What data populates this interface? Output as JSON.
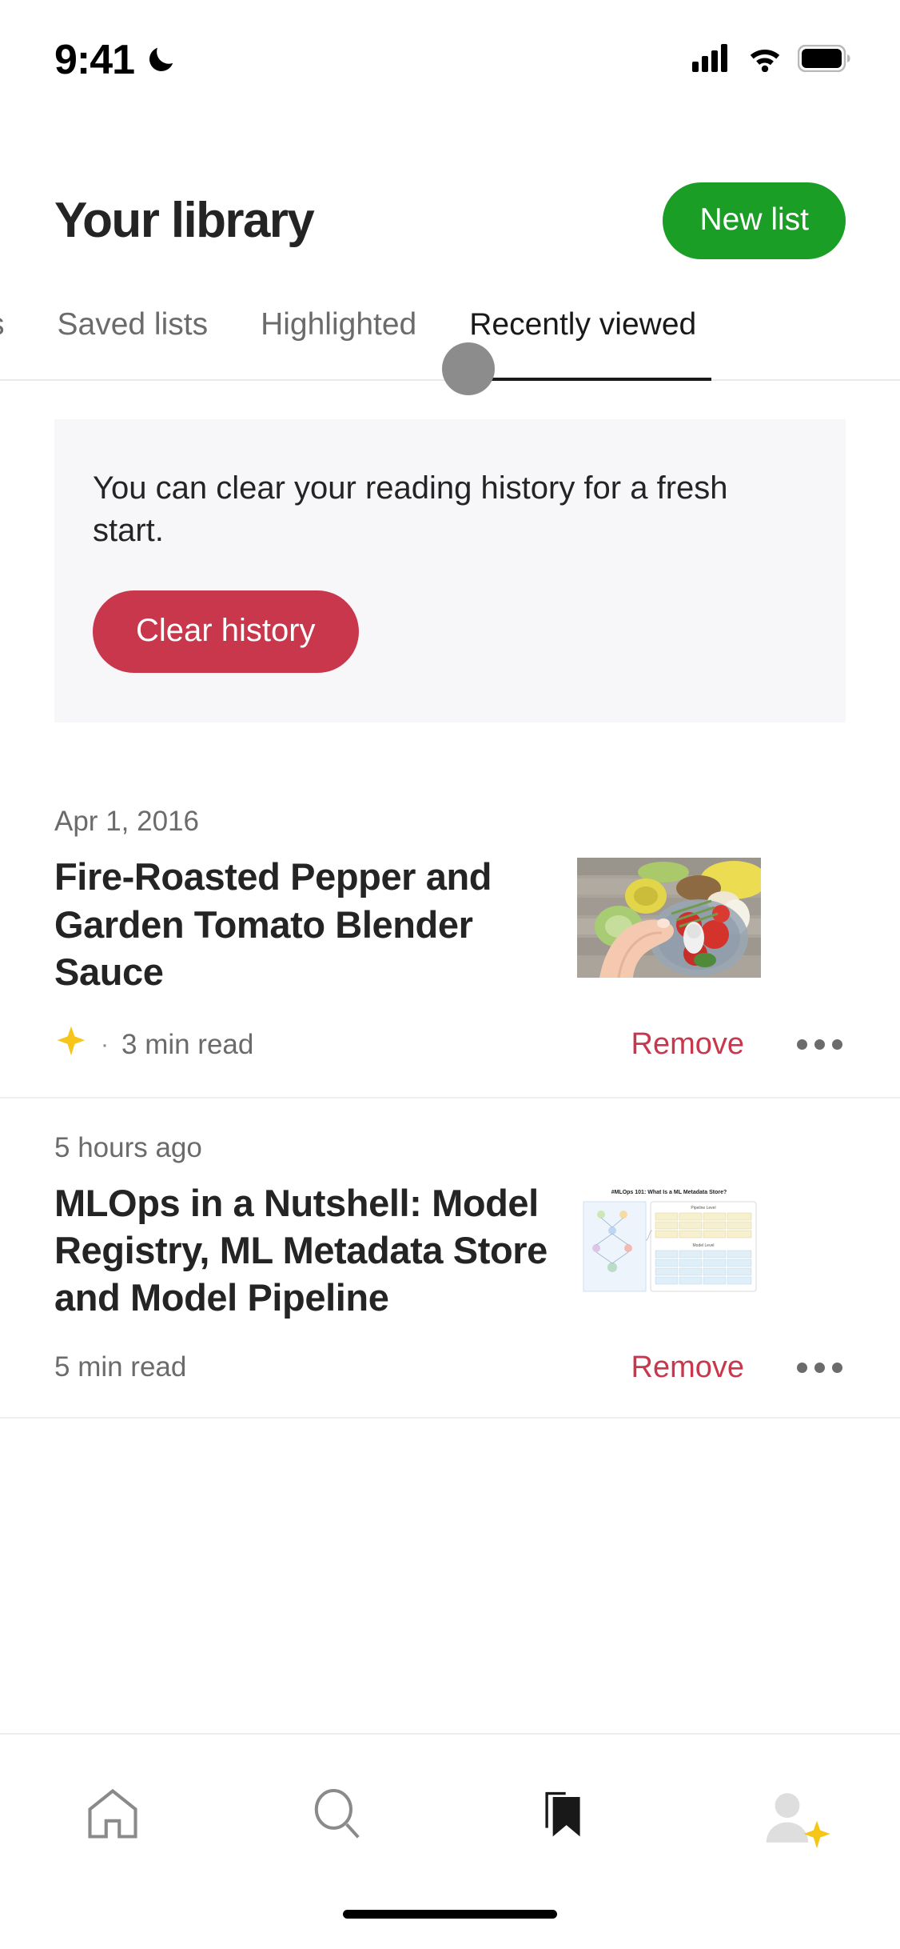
{
  "status_bar": {
    "time": "9:41",
    "dnd_icon": "crescent-moon-icon",
    "cellular_icon": "cellular-signal-icon",
    "wifi_icon": "wifi-icon",
    "battery_icon": "battery-full-icon"
  },
  "header": {
    "title": "Your library",
    "new_list_label": "New list",
    "new_list_color": "#1a9e26"
  },
  "tabs": [
    {
      "label": "s",
      "active": false,
      "clipped": true
    },
    {
      "label": "Saved lists",
      "active": false
    },
    {
      "label": "Highlighted",
      "active": false
    },
    {
      "label": "Recently viewed",
      "active": true
    }
  ],
  "notice": {
    "text": "You can clear your reading history for a fresh start.",
    "button_label": "Clear history",
    "button_color": "#c8374c",
    "background": "#f7f6f9"
  },
  "articles": [
    {
      "date": "Apr 1, 2016",
      "title": "Fire-Roasted Pepper and Garden Tomato Blender Sauce",
      "star_icon": "sparkle-star-icon",
      "has_star": true,
      "separator": "·",
      "read_time": "3 min read",
      "remove_label": "Remove",
      "more_icon": "ellipsis-icon",
      "thumbnail": "food-blender-tomatoes-photo"
    },
    {
      "date": "5 hours ago",
      "title": "MLOps in a Nutshell: Model Registry, ML Metadata Store and Model Pipeline",
      "has_star": false,
      "read_time": "5 min read",
      "remove_label": "Remove",
      "more_icon": "ellipsis-icon",
      "thumbnail": "mlops-diagram-screenshot"
    }
  ],
  "bottom_nav": [
    {
      "icon": "home-icon",
      "active": false
    },
    {
      "icon": "search-icon",
      "active": false
    },
    {
      "icon": "bookmark-icon",
      "active": true
    },
    {
      "icon": "profile-avatar-icon",
      "active": false,
      "badge": "sparkle-star-icon"
    }
  ],
  "colors": {
    "accent_green": "#1a9e26",
    "accent_red": "#c8374c",
    "text_primary": "#242424",
    "text_secondary": "#6b6b6b",
    "star_gold": "#f5c518"
  }
}
